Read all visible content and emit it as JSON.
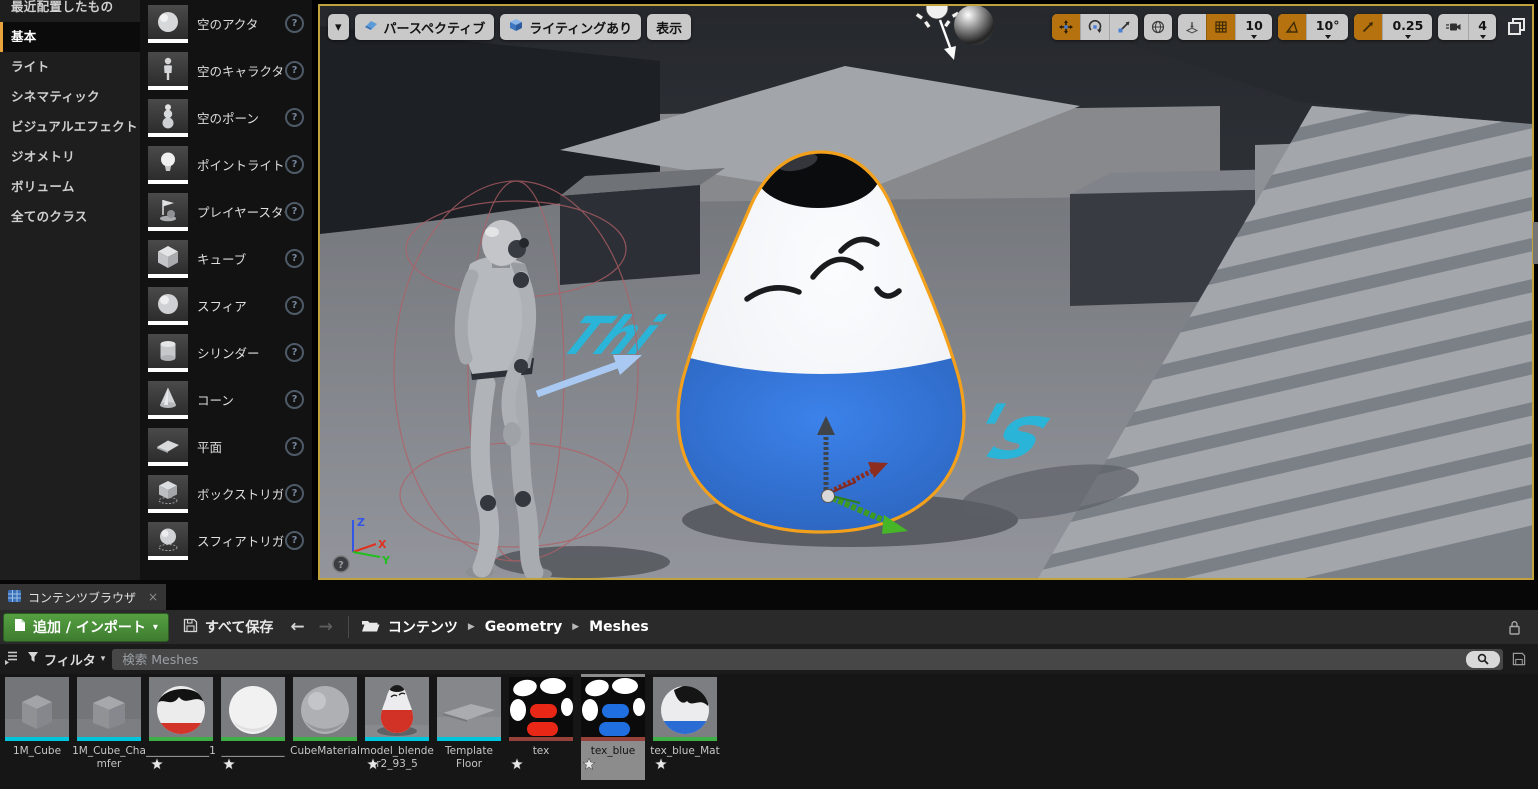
{
  "glyphs": {
    "caret_down": "▾",
    "breadcrumb_sep": "▶",
    "back_arrow": "←",
    "forward_arrow": "→",
    "close": "×",
    "help": "?"
  },
  "place_actors": {
    "categories": [
      {
        "label": "最近配置したもの",
        "selected": false
      },
      {
        "label": "基本",
        "selected": true
      },
      {
        "label": "ライト",
        "selected": false
      },
      {
        "label": "シネマティック",
        "selected": false
      },
      {
        "label": "ビジュアルエフェクト",
        "selected": false
      },
      {
        "label": "ジオメトリ",
        "selected": false
      },
      {
        "label": "ボリューム",
        "selected": false
      },
      {
        "label": "全てのクラス",
        "selected": false
      }
    ],
    "items": [
      {
        "label": "空のアクタ"
      },
      {
        "label": "空のキャラクター"
      },
      {
        "label": "空のポーン"
      },
      {
        "label": "ポイントライト"
      },
      {
        "label": "プレイヤースター"
      },
      {
        "label": "キューブ"
      },
      {
        "label": "スフィア"
      },
      {
        "label": "シリンダー"
      },
      {
        "label": "コーン"
      },
      {
        "label": "平面"
      },
      {
        "label": "ボックストリガー"
      },
      {
        "label": "スフィアトリガー"
      }
    ]
  },
  "viewport": {
    "toolbar_left": {
      "perspective": "パースペクティブ",
      "lit": "ライティングあり",
      "show": "表示"
    },
    "snap": {
      "grid_value": "10",
      "rotation_value": "10°",
      "scale_value": "0.25",
      "camera_speed": "4"
    },
    "decals": {
      "left_text": "Thi",
      "right_text": "'s"
    },
    "axis": {
      "x": "X",
      "y": "Y",
      "z": "Z"
    }
  },
  "content_browser": {
    "tab_label": "コンテンツブラウザ",
    "toolbar": {
      "add_import": "追加 / インポート",
      "save_all": "すべて保存"
    },
    "breadcrumbs": [
      "コンテンツ",
      "Geometry",
      "Meshes"
    ],
    "filter_label": "フィルタ",
    "search_placeholder": "検索 Meshes",
    "assets": [
      {
        "name": "1M_Cube",
        "type": "mesh",
        "starred": false,
        "selected": false
      },
      {
        "name": "1M_Cube_Chamfer",
        "type": "mesh",
        "starred": false,
        "selected": false
      },
      {
        "name": "____________1",
        "type": "material",
        "starred": true,
        "selected": false
      },
      {
        "name": "____________",
        "type": "material",
        "starred": true,
        "selected": false
      },
      {
        "name": "CubeMaterial",
        "type": "material",
        "starred": false,
        "selected": false
      },
      {
        "name": "model_blender2_93_5",
        "type": "mesh",
        "starred": true,
        "selected": false
      },
      {
        "name": "Template Floor",
        "type": "mesh",
        "starred": false,
        "selected": false
      },
      {
        "name": "tex",
        "type": "texture",
        "starred": true,
        "selected": false
      },
      {
        "name": "tex_blue",
        "type": "texture",
        "starred": true,
        "selected": true
      },
      {
        "name": "tex_blue_Mat",
        "type": "material",
        "starred": true,
        "selected": false
      }
    ]
  },
  "colors": {
    "accent_orange_border": "#c2a23d",
    "selection_outline": "#f3a11c",
    "snap_active": "#b5720e",
    "add_button_green": "#479138",
    "mesh_bar": "#00c6dd",
    "material_bar": "#3fae46",
    "texture_bar": "#96413a",
    "decal_cyan": "#2ab5d8",
    "character_blue": "#2e74d8"
  }
}
